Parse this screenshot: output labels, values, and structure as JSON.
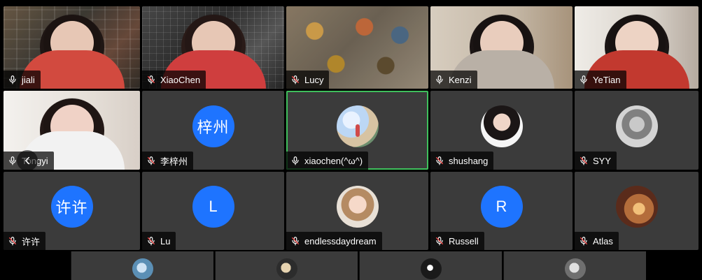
{
  "meeting": {
    "participants": [
      {
        "name": "jiali",
        "mic": "on",
        "type": "video"
      },
      {
        "name": "XiaoChen",
        "mic": "muted",
        "type": "video"
      },
      {
        "name": "Lucy",
        "mic": "muted",
        "type": "video"
      },
      {
        "name": "Kenzi",
        "mic": "on",
        "type": "video"
      },
      {
        "name": "YeTian",
        "mic": "on",
        "type": "video"
      },
      {
        "name": "Tongyi",
        "mic": "on",
        "type": "video"
      },
      {
        "name": "李梓州",
        "mic": "muted",
        "type": "avatar",
        "avatar_text": "梓州"
      },
      {
        "name": "xiaochen(^ω^)",
        "mic": "on",
        "type": "avatar_image"
      },
      {
        "name": "shushang",
        "mic": "muted",
        "type": "avatar_image"
      },
      {
        "name": "SYY",
        "mic": "muted",
        "type": "avatar_image"
      },
      {
        "name": "许许",
        "mic": "muted",
        "type": "avatar",
        "avatar_text": "许许"
      },
      {
        "name": "Lu",
        "mic": "muted",
        "type": "avatar",
        "avatar_text": "L"
      },
      {
        "name": "endlessdaydream",
        "mic": "muted",
        "type": "avatar_image"
      },
      {
        "name": "Russell",
        "mic": "muted",
        "type": "avatar",
        "avatar_text": "R"
      },
      {
        "name": "Atlas",
        "mic": "muted",
        "type": "avatar_image"
      }
    ],
    "colors": {
      "tile_bg": "#3b3b3b",
      "avatar_blue": "#1e74ff",
      "active_border": "#3fbf5c"
    },
    "icons": {
      "mic_on": "mic-icon",
      "mic_muted": "mic-muted-icon",
      "back": "chevron-left-icon"
    }
  }
}
